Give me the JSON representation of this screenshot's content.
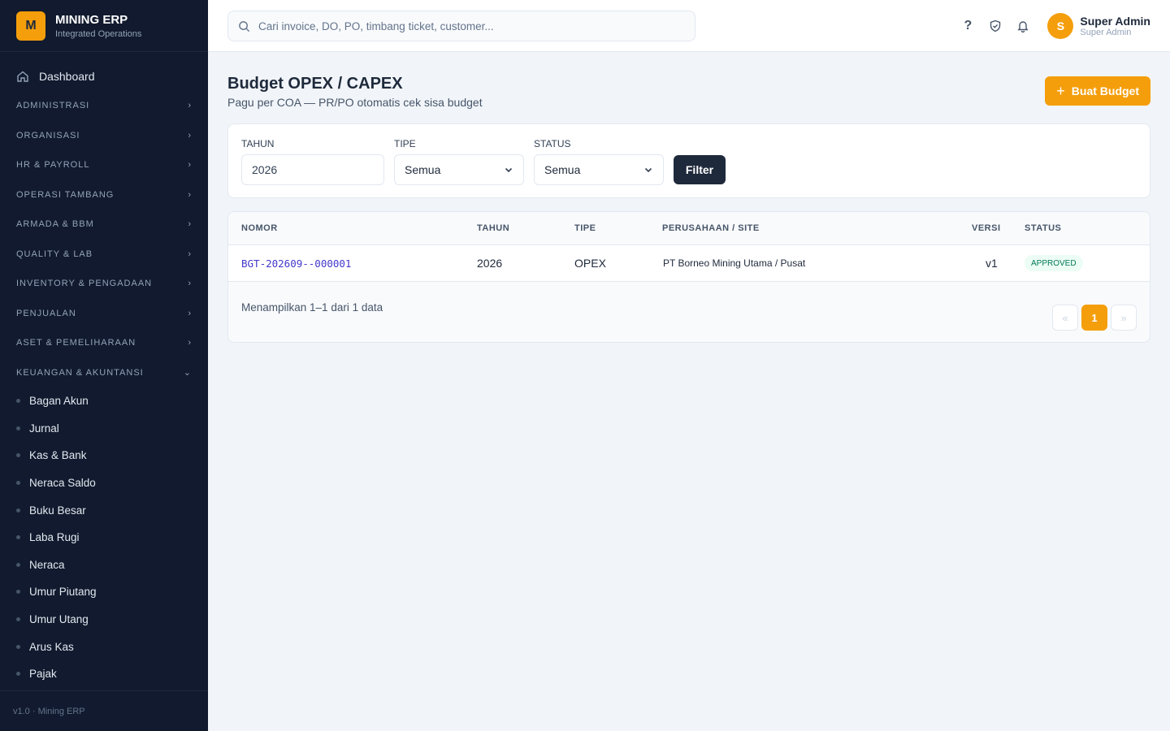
{
  "brand": {
    "logo_letter": "M",
    "title": "MINING ERP",
    "subtitle": "Integrated Operations"
  },
  "sidebar": {
    "dashboard": "Dashboard",
    "groups": [
      "ADMINISTRASI",
      "ORGANISASI",
      "HR & PAYROLL",
      "OPERASI TAMBANG",
      "ARMADA & BBM",
      "QUALITY & LAB",
      "INVENTORY & PENGADAAN",
      "PENJUALAN",
      "ASET & PEMELIHARAAN",
      "KEUANGAN & AKUNTANSI"
    ],
    "finance_items": [
      "Bagan Akun",
      "Jurnal",
      "Kas & Bank",
      "Neraca Saldo",
      "Buku Besar",
      "Laba Rugi",
      "Neraca",
      "Umur Piutang",
      "Umur Utang",
      "Arus Kas",
      "Pajak"
    ],
    "footer": "v1.0 · Mining ERP"
  },
  "search": {
    "placeholder": "Cari invoice, DO, PO, timbang ticket, customer..."
  },
  "user": {
    "avatar_letter": "S",
    "name": "Super Admin",
    "role": "Super Admin"
  },
  "page": {
    "title": "Budget OPEX / CAPEX",
    "subtitle": "Pagu per COA — PR/PO otomatis cek sisa budget",
    "create_button": "Buat Budget"
  },
  "filters": {
    "tahun_label": "TAHUN",
    "tahun_value": "2026",
    "tipe_label": "TIPE",
    "tipe_value": "Semua",
    "status_label": "STATUS",
    "status_value": "Semua",
    "filter_button": "Filter"
  },
  "table": {
    "headers": [
      "NOMOR",
      "TAHUN",
      "TIPE",
      "PERUSAHAAN / SITE",
      "VERSI",
      "STATUS"
    ],
    "rows": [
      {
        "nomor": "BGT-202609--000001",
        "tahun": "2026",
        "tipe": "OPEX",
        "perusahaan": "PT Borneo Mining Utama / Pusat",
        "versi": "v1",
        "status": "APPROVED"
      }
    ],
    "summary": "Menampilkan 1–1 dari 1 data",
    "pagination": {
      "prev": "«",
      "current": "1",
      "next": "»"
    }
  },
  "colors": {
    "sidebar_bg": "#111a2e",
    "accent": "#f59e0b",
    "dark_button": "#1e293b",
    "link": "#4338ca",
    "status_approved": "#047857"
  }
}
